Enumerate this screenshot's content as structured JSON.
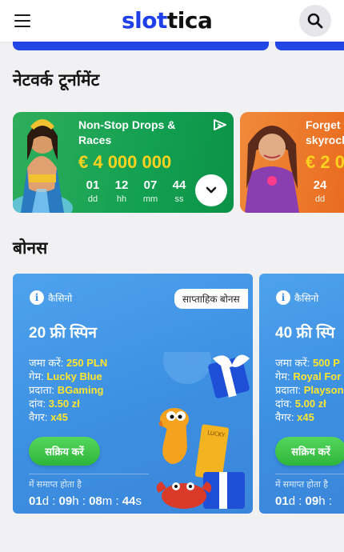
{
  "header": {
    "logo_part1": "slot",
    "logo_part2": "tica"
  },
  "tournaments": {
    "title": "नेटवर्क टूर्नामेंट",
    "cards": [
      {
        "name_line1": "Non-Stop Drops &",
        "name_line2": "Races",
        "prize": "€ 4 000 000",
        "countdown": [
          {
            "value": "01",
            "unit": "dd"
          },
          {
            "value": "12",
            "unit": "hh"
          },
          {
            "value": "07",
            "unit": "mm"
          },
          {
            "value": "44",
            "unit": "ss"
          }
        ]
      },
      {
        "name_line1": "Forget y",
        "name_line2": "skyrock",
        "prize": "€ 2 0",
        "countdown": [
          {
            "value": "24",
            "unit": "dd"
          }
        ]
      }
    ]
  },
  "bonuses": {
    "title": "बोनस",
    "cards": [
      {
        "category": "कैसिनो",
        "badge": "साप्ताहिक बोनस",
        "headline": "20 फ्री स्पिन",
        "deposit_label": "जमा करें:",
        "deposit_value": "250 PLN",
        "game_label": "गेम:",
        "game_value": "Lucky Blue",
        "provider_label": "प्रदाता:",
        "provider_value": "BGaming",
        "bet_label": "दांव:",
        "bet_value": "3.50 zł",
        "wager_label": "वैगर:",
        "wager_value": "x45",
        "button": "सक्रिय करें",
        "ends_label": "में समाप्त होता है",
        "timer": {
          "d": "01",
          "h": "09",
          "m": "08",
          "s": "44"
        }
      },
      {
        "category": "कैसिनो",
        "headline": "40 फ्री स्पि",
        "deposit_label": "जमा करें:",
        "deposit_value": "500 P",
        "game_label": "गेम:",
        "game_value": "Royal For",
        "provider_label": "प्रदाता:",
        "provider_value": "Playson",
        "bet_label": "दांव:",
        "bet_value": "5.00 zł",
        "wager_label": "वैगर:",
        "wager_value": "x45",
        "button": "सक्रिय करें",
        "ends_label": "में समाप्त होता है",
        "timer": {
          "d": "01",
          "h": "09",
          "m": "",
          "s": ""
        }
      }
    ]
  },
  "colors": {
    "brand_blue": "#1f3fe8",
    "tournament_green": "#12a051",
    "bonus_blue": "#3d8fe2",
    "highlight_yellow": "#ffe62e",
    "button_green": "#2fb53b"
  }
}
